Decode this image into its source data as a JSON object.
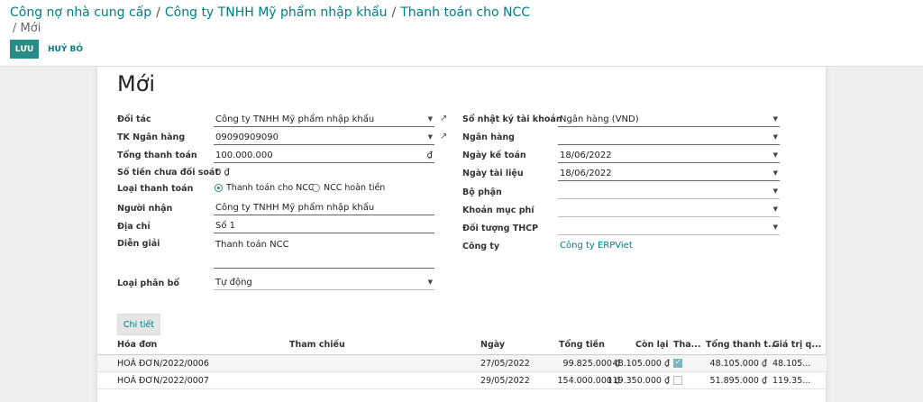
{
  "breadcrumb": {
    "items": [
      "Công nợ nhà cung cấp",
      "Công ty TNHH Mỹ phẩm nhập khẩu",
      "Thanh toán cho NCC"
    ],
    "sep": "/",
    "current": "Mới",
    "current_prefix": "/"
  },
  "toolbar": {
    "save_label": "LƯU",
    "cancel_label": "HUỶ BỎ"
  },
  "form": {
    "title": "Mới",
    "left": {
      "partner_label": "Đối tác",
      "partner_value": "Công ty TNHH Mỹ phẩm nhập khẩu",
      "bank_account_label": "TK Ngân hàng",
      "bank_account_value": "09090909090",
      "total_label": "Tổng thanh toán",
      "total_value": "100.000.000",
      "total_currency": "₫",
      "unreconciled_label": "Số tiền chưa đối soát",
      "unreconciled_value": "0 ₫",
      "payment_type_label": "Loại thanh toán",
      "payment_type_options": [
        "Thanh toán cho NCC",
        "NCC hoàn tiền"
      ],
      "payment_type_selected": "Thanh toán cho NCC",
      "recipient_label": "Người nhận",
      "recipient_value": "Công ty TNHH Mỹ phẩm nhập khẩu",
      "address_label": "Địa chỉ",
      "address_value": "Số 1",
      "description_label": "Diễn giải",
      "description_value": "Thanh toán NCC",
      "allocation_label": "Loại phân bổ",
      "allocation_value": "Tự động"
    },
    "right": {
      "journal_label": "Sổ nhật ký tài khoản",
      "journal_value": "Ngân hàng (VND)",
      "bank_label": "Ngân hàng",
      "bank_value": "",
      "accounting_date_label": "Ngày kế toán",
      "accounting_date_value": "18/06/2022",
      "document_date_label": "Ngày tài liệu",
      "document_date_value": "18/06/2022",
      "department_label": "Bộ phận",
      "department_value": "",
      "expense_item_label": "Khoản mục phí",
      "expense_item_value": "",
      "cost_object_label": "Đối tượng THCP",
      "cost_object_value": "",
      "company_label": "Công ty",
      "company_value": "Công ty ERPViet"
    }
  },
  "tabs": [
    {
      "label": "Chi tiết"
    }
  ],
  "table": {
    "headers": [
      "Hóa đơn",
      "Tham chiếu",
      "Ngày",
      "Tổng tiền",
      "Còn lại",
      "Tha...",
      "Tổng thanh t...",
      "Giá trị q..."
    ],
    "rows": [
      {
        "invoice": "HOÁ ĐƠN/2022/0006",
        "reference": "",
        "date": "27/05/2022",
        "total": "99.825.000 ₫",
        "remaining": "48.105.000 ₫",
        "paid": true,
        "payment_total": "48.105.000 ₫",
        "value": "48.105..."
      },
      {
        "invoice": "HOÁ ĐƠN/2022/0007",
        "reference": "",
        "date": "29/05/2022",
        "total": "154.000.000 ₫",
        "remaining": "119.350.000 ₫",
        "paid": false,
        "payment_total": "51.895.000 ₫",
        "value": "119.35..."
      }
    ]
  },
  "icons": {
    "caret": "caret-down-icon",
    "external": "external-link-icon",
    "check": "check-icon"
  },
  "colors": {
    "accent": "#017e84",
    "save_bg": "#2a8c86"
  }
}
